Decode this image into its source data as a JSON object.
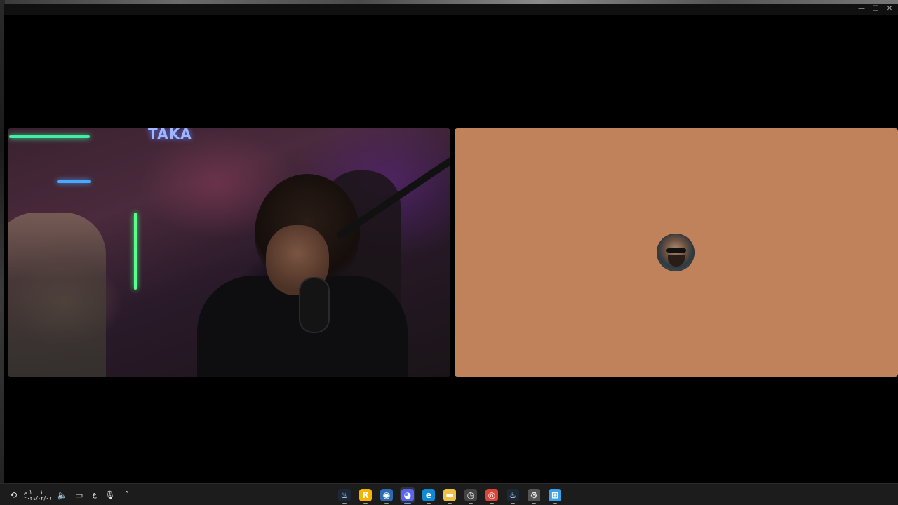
{
  "window": {
    "controls": {
      "minimize": "—",
      "maximize": "☐",
      "close": "✕"
    }
  },
  "camera_tile": {
    "neon_text": "TAKA"
  },
  "avatar_tile": {
    "background_color": "#c0825b"
  },
  "taskbar": {
    "tray": {
      "time": "١٠:٠١ م",
      "date": "٢٠٢٤/٠٣/٠١",
      "language": "ع",
      "icons": [
        "settings-sync-icon",
        "speaker-icon",
        "network-icon",
        "microphone-icon",
        "chevron-up-icon"
      ]
    },
    "apps": [
      {
        "name": "steam",
        "icon": "steam-icon",
        "color": "#1b2838",
        "glyph": "♨",
        "active": false
      },
      {
        "name": "rockstar",
        "icon": "rockstar-icon",
        "color": "#f4b400",
        "glyph": "R",
        "active": false
      },
      {
        "name": "app-blue",
        "icon": "app-icon",
        "color": "#2b6cb0",
        "glyph": "◉",
        "active": false
      },
      {
        "name": "discord",
        "icon": "discord-icon",
        "color": "#5865f2",
        "glyph": "◕",
        "active": true
      },
      {
        "name": "edge",
        "icon": "edge-icon",
        "color": "#0f8ad6",
        "glyph": "e",
        "active": false
      },
      {
        "name": "file-explorer",
        "icon": "folder-icon",
        "color": "#f0c242",
        "glyph": "▬",
        "active": false
      },
      {
        "name": "clock-app",
        "icon": "clock-icon",
        "color": "#444",
        "glyph": "◷",
        "active": false
      },
      {
        "name": "chrome",
        "icon": "chrome-icon",
        "color": "#db4437",
        "glyph": "◎",
        "active": false
      },
      {
        "name": "steam-2",
        "icon": "steam-icon",
        "color": "#1b2838",
        "glyph": "♨",
        "active": false
      },
      {
        "name": "settings",
        "icon": "gear-icon",
        "color": "#555",
        "glyph": "⚙",
        "active": false
      },
      {
        "name": "start",
        "icon": "windows-start-icon",
        "color": "#3aa0e8",
        "glyph": "⊞",
        "active": false
      }
    ]
  }
}
